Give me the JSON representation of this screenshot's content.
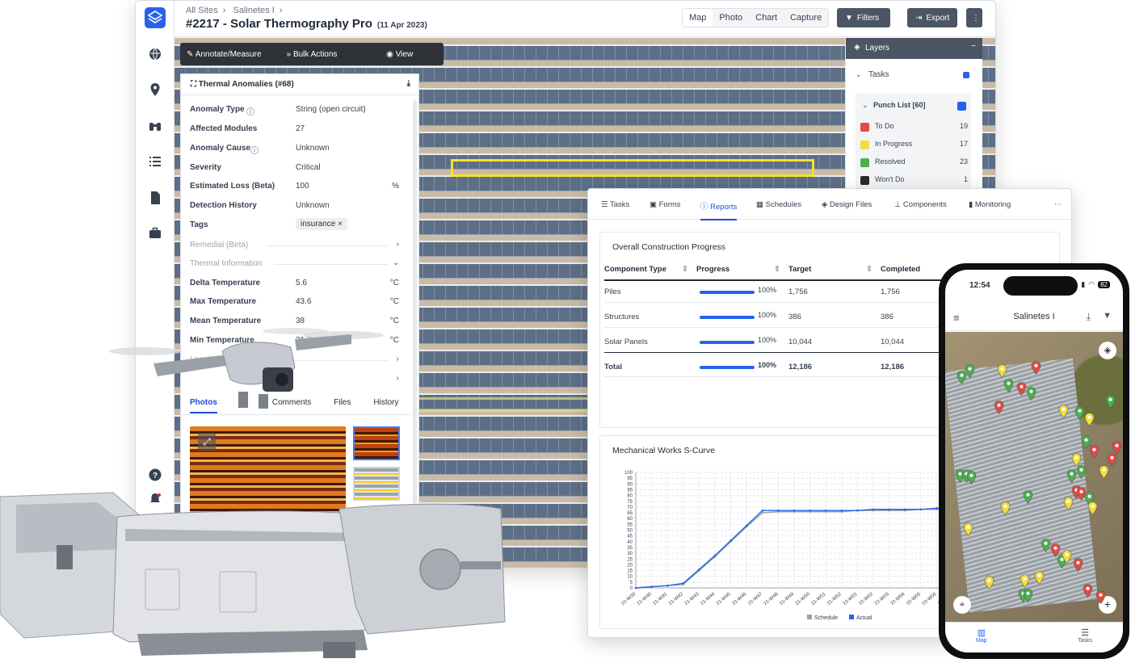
{
  "breadcrumb": {
    "root": "All Sites",
    "site": "Salinetes I"
  },
  "page": {
    "title": "#2217 - Solar Thermography Pro",
    "date": "(11 Apr 2023)"
  },
  "view_tabs": [
    "Map",
    "Photo",
    "Chart",
    "Capture"
  ],
  "active_view": "Map",
  "toolbar": {
    "filters": "Filters",
    "export": "Export"
  },
  "annotate_bar": {
    "annotate": "Annotate/Measure",
    "bulk": "Bulk Actions",
    "view": "View"
  },
  "anomaly_panel": {
    "title": "Thermal Anomalies (#68)",
    "fields": [
      {
        "label": "Anomaly Type",
        "value": "String (open circuit)",
        "unit": ""
      },
      {
        "label": "Affected Modules",
        "value": "27",
        "unit": ""
      },
      {
        "label": "Anomaly Cause",
        "value": "Unknown",
        "unit": ""
      },
      {
        "label": "Severity",
        "value": "Critical",
        "unit": ""
      },
      {
        "label": "Estimated Loss (Beta)",
        "value": "100",
        "unit": "%"
      },
      {
        "label": "Detection History",
        "value": "Unknown",
        "unit": ""
      }
    ],
    "tags_label": "Tags",
    "tag": "insurance",
    "remedial": "Remedial (Beta)",
    "thermal_info": "Thermal Information",
    "temps": [
      {
        "label": "Delta Temperature",
        "value": "5.6",
        "unit": "°C"
      },
      {
        "label": "Max Temperature",
        "value": "43.6",
        "unit": "°C"
      },
      {
        "label": "Mean Temperature",
        "value": "38",
        "unit": "°C"
      },
      {
        "label": "Min Temperature",
        "value": "21.7",
        "unit": "°C"
      }
    ],
    "location": "Location",
    "tabs": [
      "Photos",
      "Comments",
      "Files",
      "History"
    ],
    "active_tab": "Photos"
  },
  "layers": {
    "title": "Layers",
    "tasks": "Tasks",
    "punch_list": "Punch List [60]",
    "items": [
      {
        "label": "To Do",
        "count": "19",
        "color": "#e04b45"
      },
      {
        "label": "In Progress",
        "count": "17",
        "color": "#f2dd3a"
      },
      {
        "label": "Resolved",
        "count": "23",
        "color": "#4caf50"
      },
      {
        "label": "Won't Do",
        "count": "1",
        "color": "#2b2b2b"
      }
    ]
  },
  "reports": {
    "tabs": [
      "Tasks",
      "Forms",
      "Reports",
      "Schedules",
      "Design Files",
      "Components",
      "Monitoring"
    ],
    "active_tab": "Reports",
    "progress_card": {
      "title": "Overall Construction Progress",
      "headers": [
        "Component Type",
        "Progress",
        "Target",
        "Completed"
      ],
      "rows": [
        {
          "type": "Piles",
          "progress": "100%",
          "target": "1,756",
          "completed": "1,756"
        },
        {
          "type": "Structures",
          "progress": "100%",
          "target": "386",
          "completed": "386"
        },
        {
          "type": "Solar Panels",
          "progress": "100%",
          "target": "10,044",
          "completed": "10,044"
        },
        {
          "type": "Total",
          "progress": "100%",
          "target": "12,186",
          "completed": "12,186"
        }
      ]
    },
    "scurve_title": "Mechanical Works S-Curve"
  },
  "chart_data": {
    "type": "line",
    "title": "Mechanical Works S-Curve",
    "categories": [
      "21-W39",
      "21-W40",
      "21-W41",
      "21-W42",
      "21-W43",
      "21-W44",
      "21-W45",
      "21-W46",
      "21-W47",
      "21-W48",
      "21-W49",
      "21-W50",
      "21-W51",
      "21-W52",
      "22-W01",
      "22-W02",
      "22-W03",
      "22-W04",
      "22-W05",
      "22-W06",
      "22-W07"
    ],
    "series": [
      {
        "name": "Schedule",
        "color": "#9aa0a6",
        "values": [
          0,
          1,
          2,
          3,
          15,
          27,
          40,
          53,
          65,
          66,
          66,
          66,
          66,
          66,
          67,
          67,
          67,
          67,
          68,
          68,
          68
        ]
      },
      {
        "name": "Actual",
        "color": "#2563eb",
        "values": [
          0,
          1,
          2,
          4,
          16,
          28,
          41,
          54,
          67,
          67,
          67,
          67,
          67,
          67,
          67,
          68,
          68,
          68,
          68,
          69,
          69
        ]
      }
    ],
    "ylim": [
      0,
      100
    ],
    "yticks": [
      0,
      5,
      10,
      15,
      20,
      25,
      30,
      35,
      40,
      45,
      50,
      55,
      60,
      65,
      70,
      75,
      80,
      85,
      90,
      95,
      100
    ],
    "grid": true,
    "legend": "bottom"
  },
  "phone": {
    "time": "12:54",
    "battery": "82",
    "title": "Salinetes I",
    "nav": [
      "Map",
      "Tasks"
    ]
  }
}
